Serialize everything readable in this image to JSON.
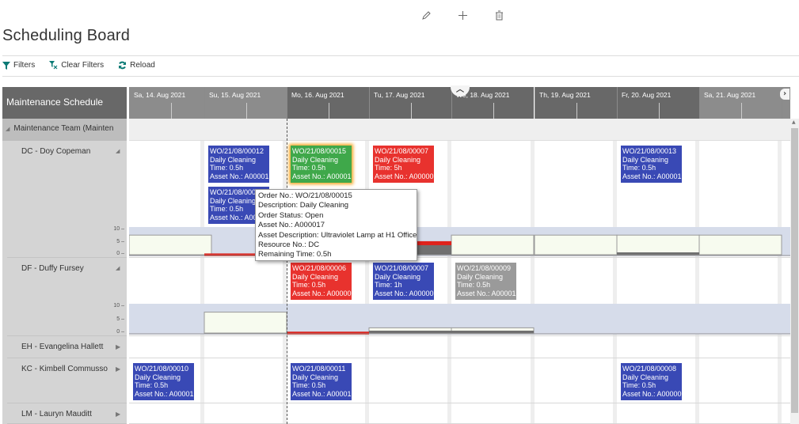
{
  "top_icons": [
    {
      "name": "edit-icon",
      "glyph": "✎"
    },
    {
      "name": "add-icon",
      "glyph": "+"
    },
    {
      "name": "delete-icon",
      "glyph": "🗑"
    }
  ],
  "page_title": "Scheduling Board",
  "actions": {
    "filters": "Filters",
    "clear_filters": "Clear Filters",
    "reload": "Reload"
  },
  "colors": {
    "accent": "#0b7a75",
    "header_bg": "#686868",
    "weekend_bg": "#8c8c8c",
    "card_blue": "#3949b5",
    "card_red": "#e8322e",
    "card_green": "#3fa84a",
    "card_gray": "#9a9a9a",
    "highlight": "#f5a623"
  },
  "board": {
    "title": "Maintenance Schedule",
    "team": "Maintenance Team (Mainten",
    "days": [
      {
        "label": "Sa, 14. Aug 2021",
        "weekend": true
      },
      {
        "label": "Su, 15. Aug 2021",
        "weekend": true
      },
      {
        "label": "Mo, 16. Aug 2021",
        "weekend": false
      },
      {
        "label": "Tu, 17. Aug 2021",
        "weekend": false
      },
      {
        "label": "We, 18. Aug 2021",
        "weekend": false
      },
      {
        "label": "Th, 19. Aug 2021",
        "weekend": false
      },
      {
        "label": "Fr, 20. Aug 2021",
        "weekend": false
      },
      {
        "label": "Sa, 21. Aug 2021",
        "weekend": true
      }
    ],
    "resources": [
      {
        "label": "DC - Doy Copeman",
        "expanded": true
      },
      {
        "label": "DF - Duffy Fursey",
        "expanded": true
      },
      {
        "label": "EH - Evangelina Hallett",
        "expanded": false
      },
      {
        "label": "KC - Kimbell Commusso",
        "expanded": false
      },
      {
        "label": "LM - Lauryn Mauditt",
        "expanded": false
      }
    ],
    "y_ticks": [
      "10",
      "5",
      "0"
    ],
    "cards": [
      {
        "resource": "DC",
        "day": 1,
        "slot": 0,
        "color": "blue",
        "order": "WO/21/08/00012",
        "desc": "Daily Cleaning",
        "time": "Time: 0.5h",
        "asset": "Asset No.: A00001"
      },
      {
        "resource": "DC",
        "day": 1,
        "slot": 1,
        "color": "blue",
        "order": "WO/21/08/00014",
        "desc": "Daily Cleaning",
        "time": "Time: 0.5h",
        "asset": "Asset No.: A00001"
      },
      {
        "resource": "DC",
        "day": 2,
        "slot": 0,
        "color": "green",
        "order": "WO/21/08/00015",
        "desc": "Daily Cleaning",
        "time": "Time: 0.5h",
        "asset": "Asset No.: A00001"
      },
      {
        "resource": "DC",
        "day": 3,
        "slot": 0,
        "color": "red",
        "order": "WO/21/08/00007",
        "desc": "Daily Cleaning",
        "time": "Time: 5h",
        "asset": "Asset No.: A00000"
      },
      {
        "resource": "DC",
        "day": 6,
        "slot": 0,
        "color": "blue",
        "order": "WO/21/08/00013",
        "desc": "Daily Cleaning",
        "time": "Time: 0.5h",
        "asset": "Asset No.: A00001"
      },
      {
        "resource": "DF",
        "day": 2,
        "slot": 0,
        "color": "red",
        "order": "WO/21/08/00006",
        "desc": "Daily Cleaning",
        "time": "Time: 0.5h",
        "asset": "Asset No.: A00000"
      },
      {
        "resource": "DF",
        "day": 3,
        "slot": 0,
        "color": "blue",
        "order": "WO/21/08/00007",
        "desc": "Daily Cleaning",
        "time": "Time: 1h",
        "asset": "Asset No.: A00000"
      },
      {
        "resource": "DF",
        "day": 4,
        "slot": 0,
        "color": "gray",
        "order": "WO/21/08/00009",
        "desc": "Daily Cleaning",
        "time": "Time: 0.5h",
        "asset": "Asset No.: A00001"
      },
      {
        "resource": "KC",
        "day": 0,
        "slot": 0,
        "color": "blue",
        "order": "WO/21/08/00010",
        "desc": "Daily Cleaning",
        "time": "Time: 0.5h",
        "asset": "Asset No.: A00001"
      },
      {
        "resource": "KC",
        "day": 2,
        "slot": 0,
        "color": "blue",
        "order": "WO/21/08/00011",
        "desc": "Daily Cleaning",
        "time": "Time: 0.5h",
        "asset": "Asset No.: A00001"
      },
      {
        "resource": "KC",
        "day": 6,
        "slot": 0,
        "color": "blue",
        "order": "WO/21/08/00008",
        "desc": "Daily Cleaning",
        "time": "Time: 0.5h",
        "asset": "Asset No.: A00000"
      }
    ],
    "capacity": {
      "DC": {
        "available": [
          8,
          0,
          0,
          0,
          8,
          8,
          8,
          8
        ],
        "booked": [
          0,
          0.5,
          0.5,
          5.5,
          0,
          0,
          0.5,
          0
        ]
      },
      "DF": {
        "available": [
          0,
          8,
          0,
          2,
          2,
          0,
          0,
          0
        ],
        "booked": [
          0,
          0,
          0.5,
          1,
          0.5,
          0,
          0,
          0
        ]
      }
    },
    "tooltip": [
      "Order No.: WO/21/08/00015",
      "Description: Daily Cleaning",
      "Order Status: Open",
      "Asset No.: A000017",
      "Asset Description: Ultraviolet Lamp at H1 Office",
      "Resource No.: DC",
      "Remaining Time: 0.5h"
    ]
  }
}
